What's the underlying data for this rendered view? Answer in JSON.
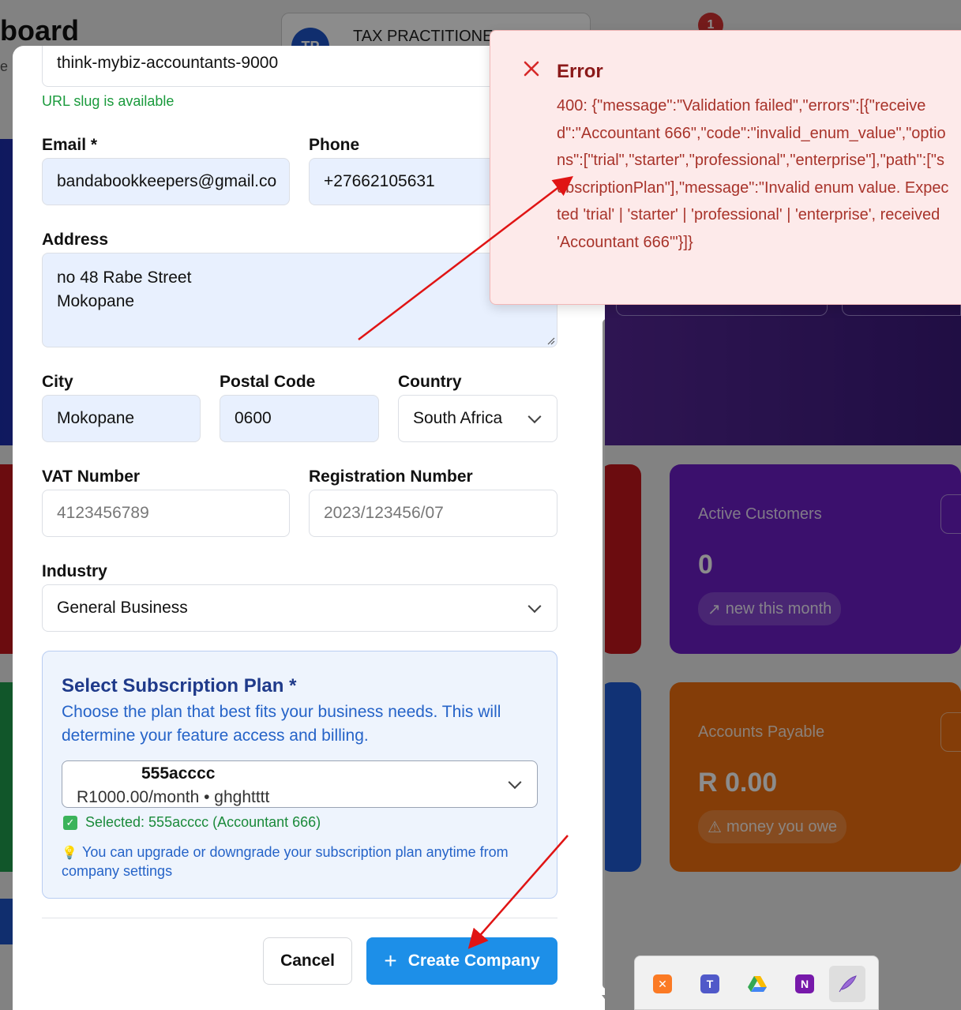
{
  "background": {
    "title_fragment": "board",
    "subtitle_fragment": "e",
    "practitioner_avatar": "TP",
    "practitioner_label": "TAX PRACTITIONE",
    "notification_count": "1",
    "card_active_customers": {
      "label": "Active Customers",
      "value": "0",
      "chip": "new this month",
      "color": "#6c1ec7"
    },
    "card_accounts_payable": {
      "label": "Accounts Payable",
      "value": "R 0.00",
      "chip": "money you owe",
      "color": "#f07010"
    }
  },
  "form": {
    "slug_value": "think-mybiz-accountants-9000",
    "slug_status": "URL slug is available",
    "email": {
      "label": "Email *",
      "value": "bandabookkeepers@gmail.co"
    },
    "phone": {
      "label": "Phone",
      "value": "+27662105631"
    },
    "address": {
      "label": "Address",
      "line1": "no 48 Rabe Street",
      "line2": "Mokopane"
    },
    "city": {
      "label": "City",
      "value": "Mokopane"
    },
    "postal_code": {
      "label": "Postal Code",
      "value": "0600"
    },
    "country": {
      "label": "Country",
      "value": "South Africa"
    },
    "vat_number": {
      "label": "VAT Number",
      "placeholder": "4123456789"
    },
    "registration_number": {
      "label": "Registration Number",
      "placeholder": "2023/123456/07"
    },
    "industry": {
      "label": "Industry",
      "value": "General Business"
    },
    "subscription": {
      "title": "Select Subscription Plan *",
      "description": "Choose the plan that best fits your business needs. This will determine your feature access and billing.",
      "selected_plan_name": "555acccc",
      "selected_plan_price": "R1000.00/month • ghghtttt",
      "selected_confirmation": "Selected: 555acccc (Accountant 666)",
      "tip": "You can upgrade or downgrade your subscription plan anytime from company settings"
    },
    "buttons": {
      "cancel": "Cancel",
      "create": "Create Company"
    }
  },
  "error_toast": {
    "title": "Error",
    "message": "400: {\"message\":\"Validation failed\",\"errors\":[{\"received\":\"Accountant 666\",\"code\":\"invalid_enum_value\",\"options\":[\"trial\",\"starter\",\"professional\",\"enterprise\"],\"path\":[\"subscriptionPlan\"],\"message\":\"Invalid enum value. Expected 'trial' | 'starter' | 'professional' | 'enterprise', received 'Accountant 666'\"}]}"
  },
  "taskbar": {
    "apps": [
      "xampp-icon",
      "teams-icon",
      "google-drive-icon",
      "onenote-icon",
      "feather-app-icon"
    ]
  },
  "colors": {
    "primary_button": "#1d8fe8",
    "error_text": "#a8332a",
    "success_text": "#1a9a3c",
    "plan_box_bg": "#eef4fd",
    "annotation_arrow": "#e01414"
  }
}
